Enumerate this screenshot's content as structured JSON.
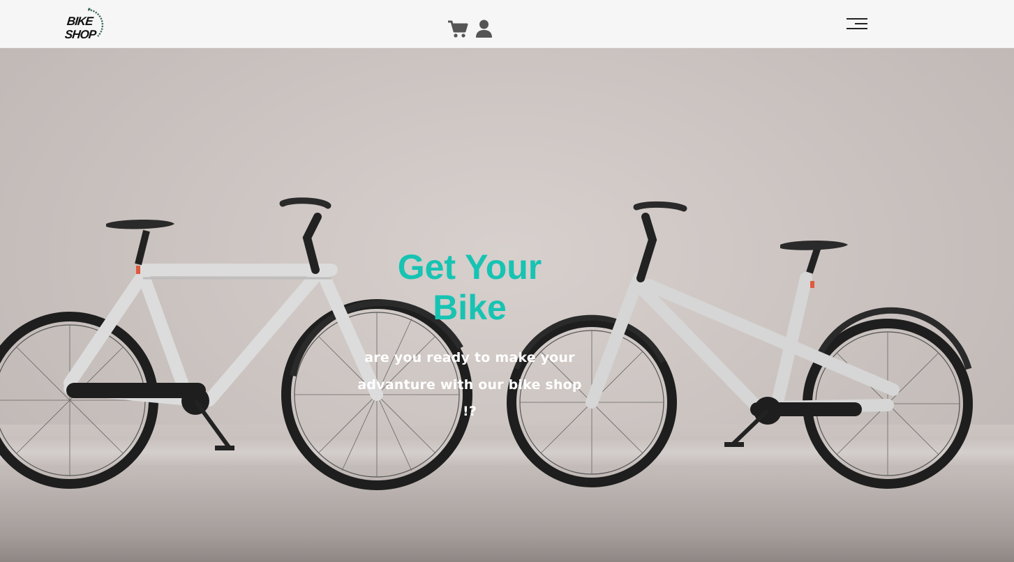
{
  "header": {
    "logo": {
      "line1": "BIKE",
      "line2": "SHOP"
    },
    "icons": [
      "cart-icon",
      "user-icon",
      "menu-icon"
    ]
  },
  "hero": {
    "title": "Get Your Bike",
    "subtitle": "are you ready to make your advanture with our bike shop !?"
  },
  "colors": {
    "accent": "#17c3b2",
    "header_bg": "#f6f6f6",
    "icon": "#555555",
    "hero_text": "#ffffff"
  }
}
